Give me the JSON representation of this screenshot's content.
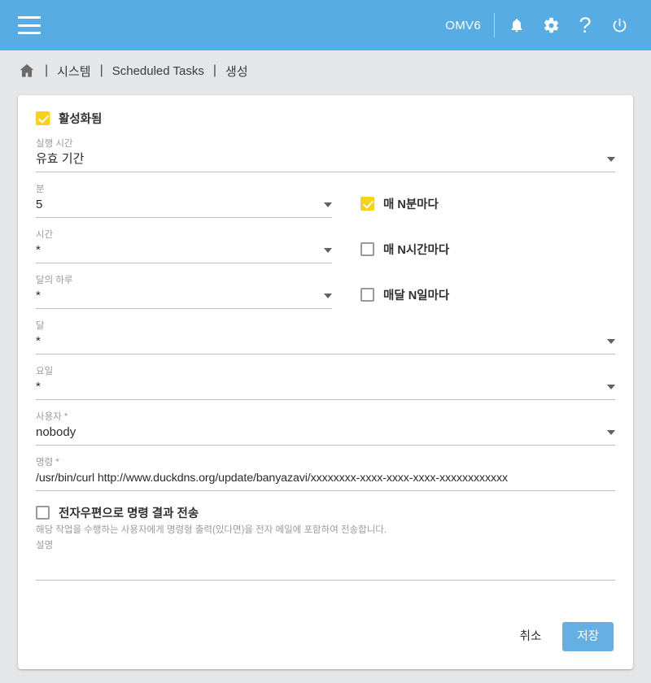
{
  "appbar": {
    "menu_icon": "hamburger-menu-icon",
    "brand": "OMV6",
    "actions": [
      {
        "icon": "bell-icon",
        "name": "notifications-button"
      },
      {
        "icon": "gear-icon",
        "name": "settings-button"
      },
      {
        "icon": "question-mark-icon",
        "name": "help-button",
        "glyph": "?"
      },
      {
        "icon": "power-icon",
        "name": "power-button"
      }
    ]
  },
  "breadcrumb": {
    "home_icon": "home-icon",
    "separator": "|",
    "items": [
      "시스템",
      "Scheduled Tasks",
      "생성"
    ]
  },
  "form": {
    "enabled": {
      "label": "활성화됨",
      "checked": true
    },
    "execution_time": {
      "label": "실행 시간",
      "value": "유효 기간"
    },
    "minute": {
      "label": "분",
      "value": "5",
      "toggle_label": "매 N분마다",
      "toggle_checked": true
    },
    "hour": {
      "label": "시간",
      "value": "*",
      "toggle_label": "매 N시간마다",
      "toggle_checked": false
    },
    "day_of_month": {
      "label": "달의 하루",
      "value": "*",
      "toggle_label": "매달 N일마다",
      "toggle_checked": false
    },
    "month": {
      "label": "달",
      "value": "*"
    },
    "day_of_week": {
      "label": "요일",
      "value": "*"
    },
    "user": {
      "label": "사용자 *",
      "value": "nobody"
    },
    "command": {
      "label": "명령 *",
      "value": "/usr/bin/curl http://www.duckdns.org/update/banyazavi/xxxxxxxx-xxxx-xxxx-xxxx-xxxxxxxxxxxx"
    },
    "send_email": {
      "label": "전자우편으로 명령 결과 전송",
      "checked": false,
      "hint": "해당 작업을 수행하는 사용자에게 명령형 출력(있다면)을 전자 메일에 포함하여 전송합니다."
    },
    "description": {
      "label": "설명",
      "value": ""
    }
  },
  "footer": {
    "cancel_label": "취소",
    "save_label": "저장"
  },
  "colors": {
    "appbar": "#57ace3",
    "accent_checkbox": "#f9d313",
    "primary_button": "#64b0e4",
    "page_background": "#e4e6e8"
  }
}
